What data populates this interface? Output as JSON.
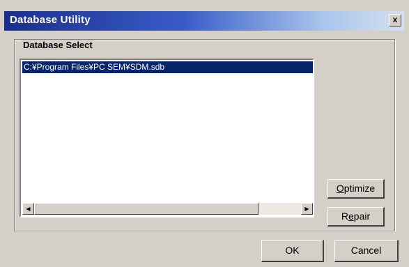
{
  "window": {
    "title": "Database Utility",
    "close_label": "x"
  },
  "group": {
    "label": "Database Select"
  },
  "list": {
    "items": [
      {
        "path": "C:¥Program Files¥PC SEM¥SDM.sdb",
        "selected": true
      }
    ]
  },
  "scrollbar": {
    "left_arrow": "◀",
    "right_arrow": "▶"
  },
  "buttons": {
    "optimize_mnemonic": "O",
    "optimize_rest": "ptimize",
    "repair_first": "R",
    "repair_mnemonic": "e",
    "repair_rest": "pair",
    "ok": "OK",
    "cancel": "Cancel"
  },
  "colors": {
    "title_bar_start": "#1a2f8c",
    "selection": "#0a246a",
    "face": "#d4d0c8"
  }
}
